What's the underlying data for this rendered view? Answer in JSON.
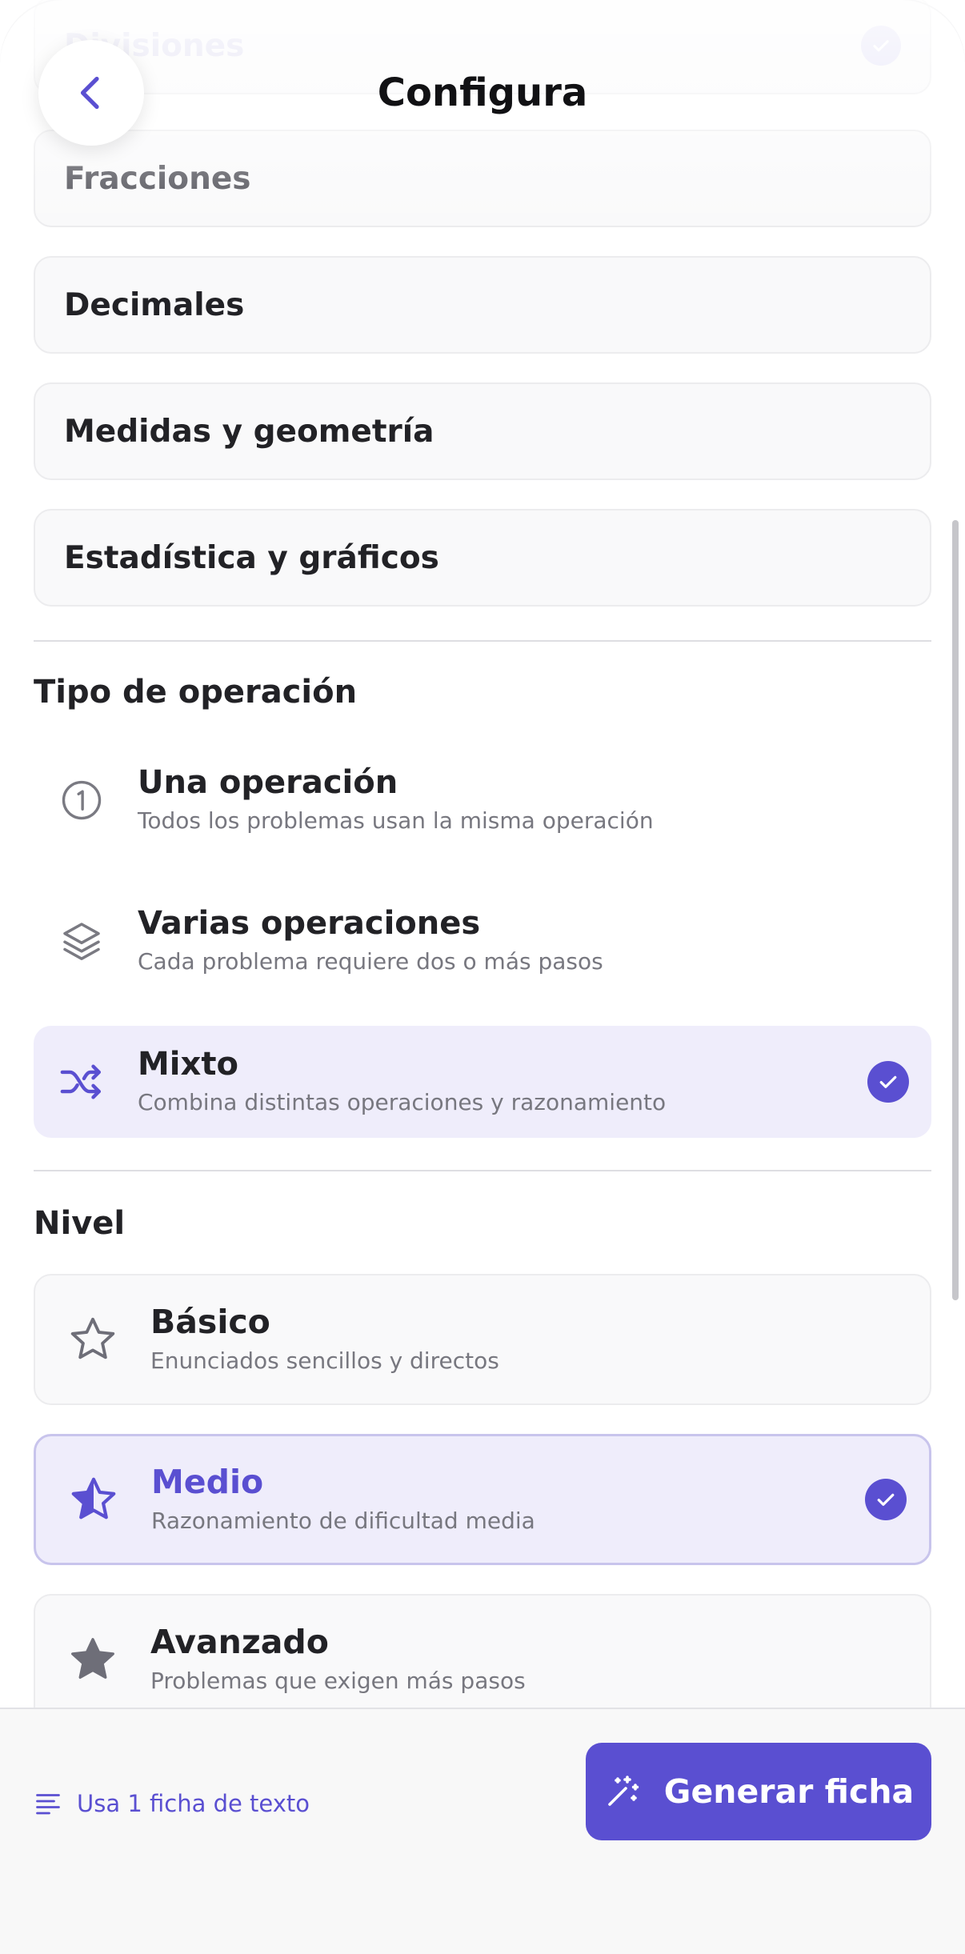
{
  "header": {
    "title": "Configura"
  },
  "topics": [
    {
      "label": "Divisiones",
      "faded": true
    },
    {
      "label": "Fracciones"
    },
    {
      "label": "Decimales"
    },
    {
      "label": "Medidas y geometría"
    },
    {
      "label": "Estadística y gráficos"
    }
  ],
  "operation": {
    "title": "Tipo de operación",
    "options": [
      {
        "title": "Una operación",
        "subtitle": "Todos los problemas usan la misma operación",
        "icon": "number-one-circle-icon",
        "selected": false
      },
      {
        "title": "Varias operaciones",
        "subtitle": "Cada problema requiere dos o más pasos",
        "icon": "layers-icon",
        "selected": false
      },
      {
        "title": "Mixto",
        "subtitle": "Combina distintas operaciones y razonamiento",
        "icon": "shuffle-icon",
        "selected": true
      }
    ]
  },
  "level": {
    "title": "Nivel",
    "options": [
      {
        "title": "Básico",
        "subtitle": "Enunciados sencillos y directos",
        "icon": "star-outline-icon",
        "selected": false
      },
      {
        "title": "Medio",
        "subtitle": "Razonamiento de dificultad media",
        "icon": "star-half-icon",
        "selected": true
      },
      {
        "title": "Avanzado",
        "subtitle": "Problemas que exigen más pasos",
        "icon": "star-filled-icon",
        "selected": false
      }
    ]
  },
  "footer": {
    "quota_text": "Usa 1 ficha de texto",
    "generate_label": "Generar ficha"
  },
  "colors": {
    "accent": "#5a4fd1",
    "selected_bg": "#efedfb",
    "card_bg": "#f9f9fa"
  }
}
